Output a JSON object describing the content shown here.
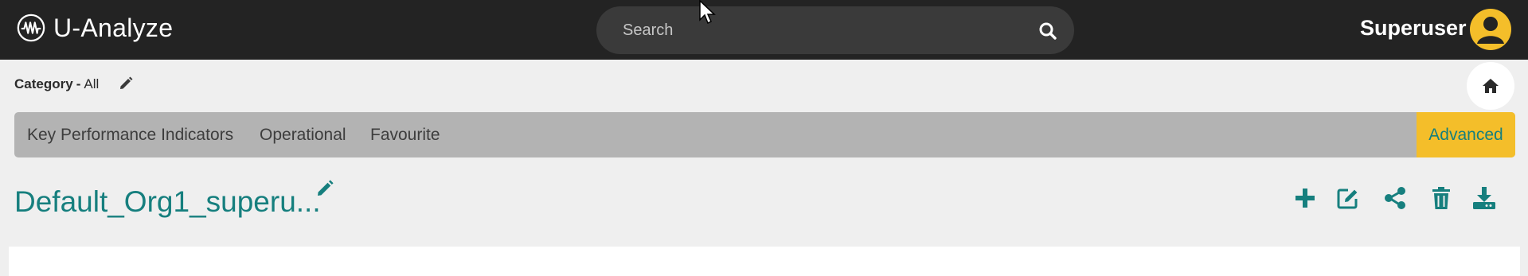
{
  "app": {
    "name": "U-Analyze"
  },
  "search": {
    "placeholder": "Search"
  },
  "user": {
    "name": "Superuser"
  },
  "category": {
    "label": "Category",
    "separator": "-",
    "value": "All"
  },
  "tabs": {
    "items": [
      {
        "label": "Key Performance Indicators"
      },
      {
        "label": "Operational"
      },
      {
        "label": "Favourite"
      },
      {
        "label": "Advanced",
        "active": true
      }
    ]
  },
  "dashboard": {
    "title": "Default_Org1_superu..."
  },
  "icons": {
    "logo": "waveform-circle-icon",
    "search": "search-icon",
    "avatar": "user-avatar-icon",
    "category_edit": "pencil-icon",
    "home": "home-icon",
    "title_edit": "pencil-icon",
    "add": "plus-icon",
    "edit": "edit-square-icon",
    "share": "share-icon",
    "delete": "trash-icon",
    "download": "download-icon"
  },
  "colors": {
    "topbar": "#232323",
    "accent_teal": "#167f7e",
    "accent_yellow": "#f4be2a",
    "tabbar": "#b3b3b3",
    "background": "#efefef"
  }
}
